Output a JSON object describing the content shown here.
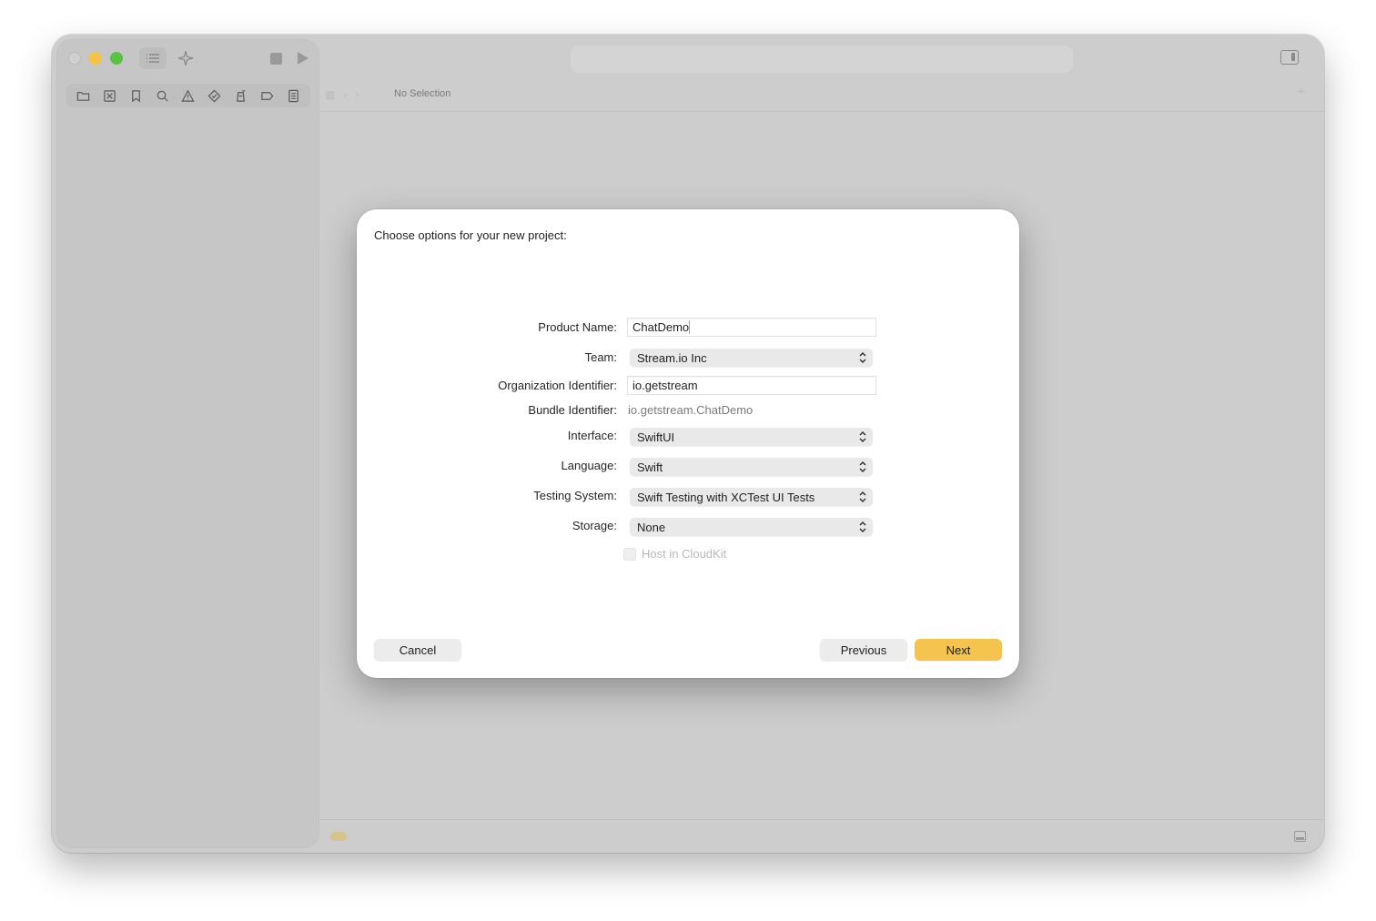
{
  "window": {
    "no_selection": "No Selection"
  },
  "toolbar": {
    "nav_icons": [
      "folder-icon",
      "source-control-icon",
      "bookmark-icon",
      "search-icon",
      "warning-icon",
      "test-icon",
      "debug-icon",
      "breakpoint-icon",
      "report-icon"
    ]
  },
  "dialog": {
    "title": "Choose options for your new project:",
    "product_name": {
      "label": "Product Name:",
      "value": "ChatDemo"
    },
    "team": {
      "label": "Team:",
      "value": "Stream.io Inc"
    },
    "org_identifier": {
      "label": "Organization Identifier:",
      "value": "io.getstream"
    },
    "bundle_identifier": {
      "label": "Bundle Identifier:",
      "value": "io.getstream.ChatDemo"
    },
    "interface": {
      "label": "Interface:",
      "value": "SwiftUI"
    },
    "language": {
      "label": "Language:",
      "value": "Swift"
    },
    "testing_system": {
      "label": "Testing System:",
      "value": "Swift Testing with XCTest UI Tests"
    },
    "storage": {
      "label": "Storage:",
      "value": "None"
    },
    "host_in_cloudkit": {
      "label": "Host in CloudKit",
      "checked": false,
      "enabled": false
    },
    "buttons": {
      "cancel": "Cancel",
      "previous": "Previous",
      "next": "Next"
    }
  },
  "colors": {
    "accent": "#f4c44e",
    "window_bg": "#cdcdcd",
    "dialog_bg": "#ffffff"
  }
}
